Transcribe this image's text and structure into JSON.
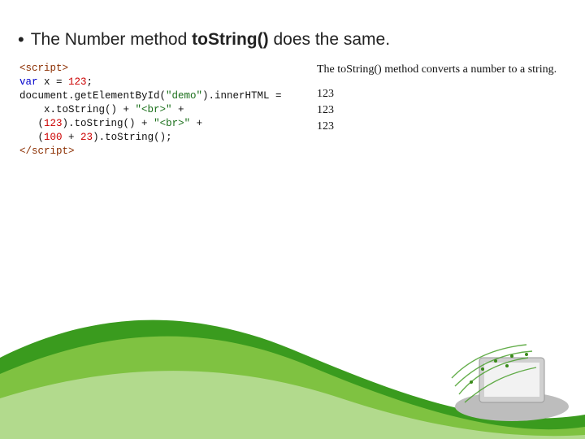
{
  "bullet": {
    "before": "The Number method ",
    "bold": "toString()",
    "after": " does the same."
  },
  "code": {
    "l1a": "<script>",
    "l2a": "var",
    "l2b": " x = ",
    "l2c": "123",
    "l2d": ";",
    "l3a": "document.getElementById(",
    "l3b": "\"demo\"",
    "l3c": ").innerHTML =",
    "l4a": "    x.toString() + ",
    "l4b": "\"<br>\"",
    "l4c": " +",
    "l5a": "   (",
    "l5b": "123",
    "l5c": ").toString() + ",
    "l5d": "\"<br>\"",
    "l5e": " +",
    "l6a": "   (",
    "l6b": "100",
    "l6c": " + ",
    "l6d": "23",
    "l6e": ").toString();",
    "l7a": "</script>"
  },
  "output": {
    "desc": "The toString() method converts a number to a string.",
    "l1": "123",
    "l2": "123",
    "l3": "123"
  }
}
